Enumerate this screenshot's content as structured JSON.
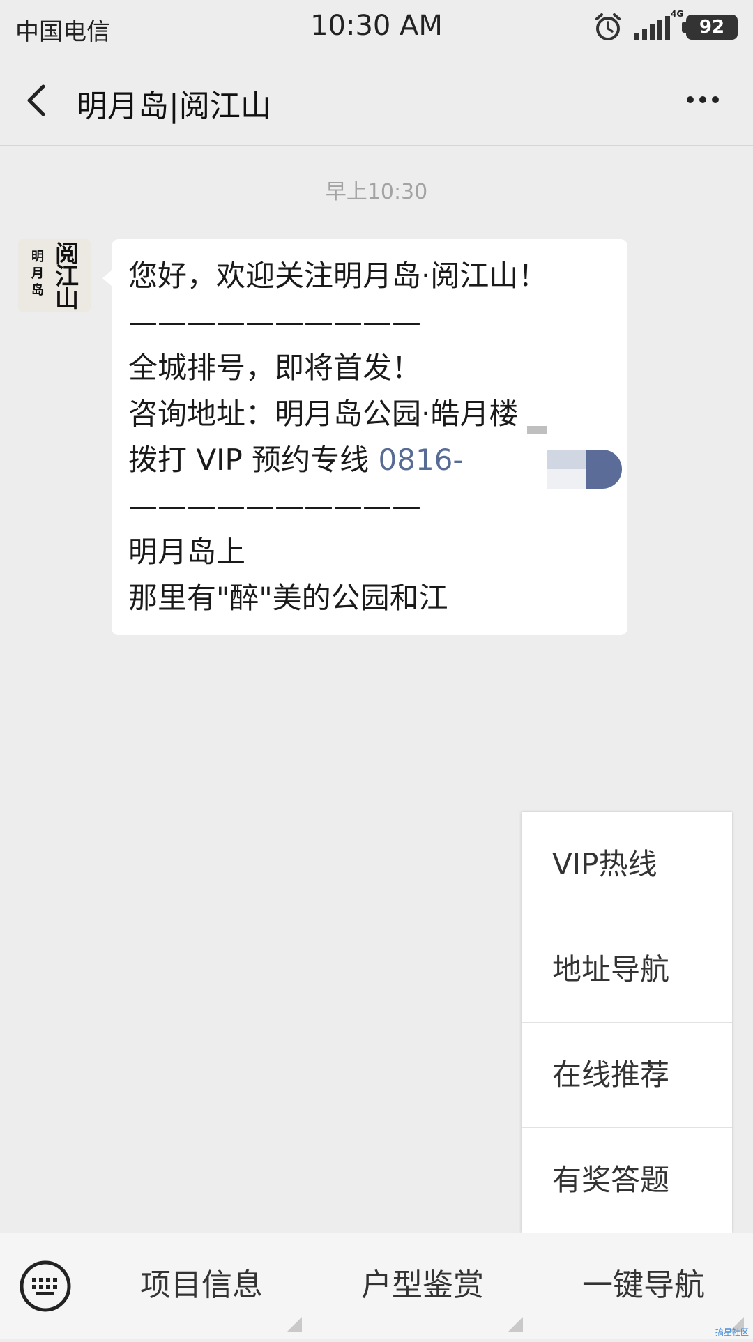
{
  "status_bar": {
    "carrier": "中国电信",
    "time": "10:30 AM",
    "network": "4G",
    "battery": "92"
  },
  "nav": {
    "title": "明月岛|阅江山"
  },
  "chat": {
    "timestamp": "早上10:30",
    "avatar": {
      "small_text": "明月岛",
      "big_text": "阅江山"
    },
    "message": {
      "greeting": "您好，欢迎关注明月岛·阅江山！",
      "divider": "——————————",
      "line_launch": "全城排号，即将首发！",
      "line_address": "咨询地址：明月岛公园·皓月楼",
      "line_vip_prefix": "拨打 VIP 预约专线 ",
      "line_vip_phone": "0816-",
      "line_island": "明月岛上",
      "line_park": "那里有\"醉\"美的公园和江"
    }
  },
  "popup_menu": {
    "items": [
      {
        "label": "VIP热线"
      },
      {
        "label": "地址导航"
      },
      {
        "label": "在线推荐"
      },
      {
        "label": "有奖答题"
      }
    ]
  },
  "bottom_bar": {
    "tabs": [
      {
        "label": "项目信息"
      },
      {
        "label": "户型鉴赏"
      },
      {
        "label": "一键导航"
      }
    ],
    "watermark": "搞星社区"
  }
}
